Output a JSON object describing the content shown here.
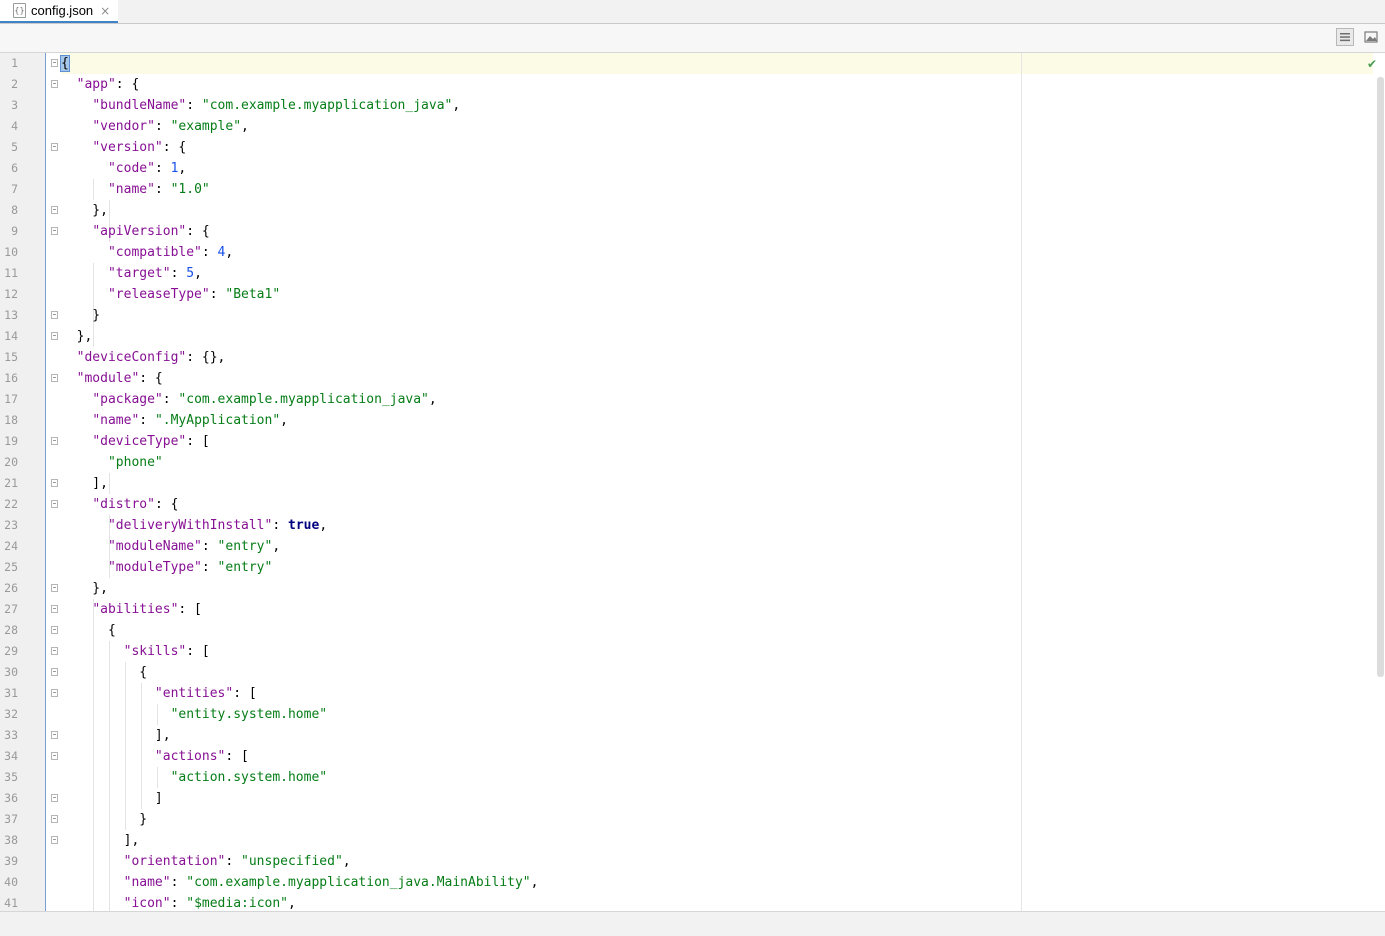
{
  "tab": {
    "label": "config.json",
    "icon": "json-file-icon",
    "close": "×"
  },
  "status": {
    "inspection": "✔"
  },
  "lines": [
    {
      "n": "1",
      "t": [
        [
          "p",
          "{"
        ]
      ]
    },
    {
      "n": "2",
      "t": [
        [
          "p",
          "  "
        ],
        [
          "k",
          "\"app\""
        ],
        [
          "p",
          ": {"
        ]
      ]
    },
    {
      "n": "3",
      "t": [
        [
          "p",
          "    "
        ],
        [
          "k",
          "\"bundleName\""
        ],
        [
          "p",
          ": "
        ],
        [
          "s",
          "\"com.example.myapplication_java\""
        ],
        [
          "p",
          ","
        ]
      ]
    },
    {
      "n": "4",
      "t": [
        [
          "p",
          "    "
        ],
        [
          "k",
          "\"vendor\""
        ],
        [
          "p",
          ": "
        ],
        [
          "s",
          "\"example\""
        ],
        [
          "p",
          ","
        ]
      ]
    },
    {
      "n": "5",
      "t": [
        [
          "p",
          "    "
        ],
        [
          "k",
          "\"version\""
        ],
        [
          "p",
          ": {"
        ]
      ]
    },
    {
      "n": "6",
      "t": [
        [
          "p",
          "      "
        ],
        [
          "k",
          "\"code\""
        ],
        [
          "p",
          ": "
        ],
        [
          "n",
          "1"
        ],
        [
          "p",
          ","
        ]
      ]
    },
    {
      "n": "7",
      "t": [
        [
          "p",
          "      "
        ],
        [
          "k",
          "\"name\""
        ],
        [
          "p",
          ": "
        ],
        [
          "s",
          "\"1.0\""
        ]
      ]
    },
    {
      "n": "8",
      "t": [
        [
          "p",
          "    },"
        ]
      ]
    },
    {
      "n": "9",
      "t": [
        [
          "p",
          "    "
        ],
        [
          "k",
          "\"apiVersion\""
        ],
        [
          "p",
          ": {"
        ]
      ]
    },
    {
      "n": "10",
      "t": [
        [
          "p",
          "      "
        ],
        [
          "k",
          "\"compatible\""
        ],
        [
          "p",
          ": "
        ],
        [
          "n",
          "4"
        ],
        [
          "p",
          ","
        ]
      ]
    },
    {
      "n": "11",
      "t": [
        [
          "p",
          "      "
        ],
        [
          "k",
          "\"target\""
        ],
        [
          "p",
          ": "
        ],
        [
          "n",
          "5"
        ],
        [
          "p",
          ","
        ]
      ]
    },
    {
      "n": "12",
      "t": [
        [
          "p",
          "      "
        ],
        [
          "k",
          "\"releaseType\""
        ],
        [
          "p",
          ": "
        ],
        [
          "s",
          "\"Beta1\""
        ]
      ]
    },
    {
      "n": "13",
      "t": [
        [
          "p",
          "    }"
        ]
      ]
    },
    {
      "n": "14",
      "t": [
        [
          "p",
          "  },"
        ]
      ]
    },
    {
      "n": "15",
      "t": [
        [
          "p",
          "  "
        ],
        [
          "k",
          "\"deviceConfig\""
        ],
        [
          "p",
          ": {},"
        ]
      ]
    },
    {
      "n": "16",
      "t": [
        [
          "p",
          "  "
        ],
        [
          "k",
          "\"module\""
        ],
        [
          "p",
          ": {"
        ]
      ]
    },
    {
      "n": "17",
      "t": [
        [
          "p",
          "    "
        ],
        [
          "k",
          "\"package\""
        ],
        [
          "p",
          ": "
        ],
        [
          "s",
          "\"com.example.myapplication_java\""
        ],
        [
          "p",
          ","
        ]
      ]
    },
    {
      "n": "18",
      "t": [
        [
          "p",
          "    "
        ],
        [
          "k",
          "\"name\""
        ],
        [
          "p",
          ": "
        ],
        [
          "s",
          "\".MyApplication\""
        ],
        [
          "p",
          ","
        ]
      ]
    },
    {
      "n": "19",
      "t": [
        [
          "p",
          "    "
        ],
        [
          "k",
          "\"deviceType\""
        ],
        [
          "p",
          ": ["
        ]
      ]
    },
    {
      "n": "20",
      "t": [
        [
          "p",
          "      "
        ],
        [
          "s",
          "\"phone\""
        ]
      ]
    },
    {
      "n": "21",
      "t": [
        [
          "p",
          "    ],"
        ]
      ]
    },
    {
      "n": "22",
      "t": [
        [
          "p",
          "    "
        ],
        [
          "k",
          "\"distro\""
        ],
        [
          "p",
          ": {"
        ]
      ]
    },
    {
      "n": "23",
      "t": [
        [
          "p",
          "      "
        ],
        [
          "k",
          "\"deliveryWithInstall\""
        ],
        [
          "p",
          ": "
        ],
        [
          "b",
          "true"
        ],
        [
          "p",
          ","
        ]
      ]
    },
    {
      "n": "24",
      "t": [
        [
          "p",
          "      "
        ],
        [
          "k",
          "\"moduleName\""
        ],
        [
          "p",
          ": "
        ],
        [
          "s",
          "\"entry\""
        ],
        [
          "p",
          ","
        ]
      ]
    },
    {
      "n": "25",
      "t": [
        [
          "p",
          "      "
        ],
        [
          "k",
          "\"moduleType\""
        ],
        [
          "p",
          ": "
        ],
        [
          "s",
          "\"entry\""
        ]
      ]
    },
    {
      "n": "26",
      "t": [
        [
          "p",
          "    },"
        ]
      ]
    },
    {
      "n": "27",
      "t": [
        [
          "p",
          "    "
        ],
        [
          "k",
          "\"abilities\""
        ],
        [
          "p",
          ": ["
        ]
      ]
    },
    {
      "n": "28",
      "t": [
        [
          "p",
          "      {"
        ]
      ]
    },
    {
      "n": "29",
      "t": [
        [
          "p",
          "        "
        ],
        [
          "k",
          "\"skills\""
        ],
        [
          "p",
          ": ["
        ]
      ]
    },
    {
      "n": "30",
      "t": [
        [
          "p",
          "          {"
        ]
      ]
    },
    {
      "n": "31",
      "t": [
        [
          "p",
          "            "
        ],
        [
          "k",
          "\"entities\""
        ],
        [
          "p",
          ": ["
        ]
      ]
    },
    {
      "n": "32",
      "t": [
        [
          "p",
          "              "
        ],
        [
          "s",
          "\"entity.system.home\""
        ]
      ]
    },
    {
      "n": "33",
      "t": [
        [
          "p",
          "            ],"
        ]
      ]
    },
    {
      "n": "34",
      "t": [
        [
          "p",
          "            "
        ],
        [
          "k",
          "\"actions\""
        ],
        [
          "p",
          ": ["
        ]
      ]
    },
    {
      "n": "35",
      "t": [
        [
          "p",
          "              "
        ],
        [
          "s",
          "\"action.system.home\""
        ]
      ]
    },
    {
      "n": "36",
      "t": [
        [
          "p",
          "            ]"
        ]
      ]
    },
    {
      "n": "37",
      "t": [
        [
          "p",
          "          }"
        ]
      ]
    },
    {
      "n": "38",
      "t": [
        [
          "p",
          "        ],"
        ]
      ]
    },
    {
      "n": "39",
      "t": [
        [
          "p",
          "        "
        ],
        [
          "k",
          "\"orientation\""
        ],
        [
          "p",
          ": "
        ],
        [
          "s",
          "\"unspecified\""
        ],
        [
          "p",
          ","
        ]
      ]
    },
    {
      "n": "40",
      "t": [
        [
          "p",
          "        "
        ],
        [
          "k",
          "\"name\""
        ],
        [
          "p",
          ": "
        ],
        [
          "s",
          "\"com.example.myapplication_java.MainAbility\""
        ],
        [
          "p",
          ","
        ]
      ]
    },
    {
      "n": "41",
      "t": [
        [
          "p",
          "        "
        ],
        [
          "k",
          "\"icon\""
        ],
        [
          "p",
          ": "
        ],
        [
          "s",
          "\"$media:icon\""
        ],
        [
          "p",
          ","
        ]
      ]
    }
  ],
  "folds": [
    "1",
    "2",
    "5",
    "8",
    "9",
    "13",
    "14",
    "16",
    "19",
    "21",
    "22",
    "26",
    "27",
    "28",
    "29",
    "30",
    "31",
    "33",
    "34",
    "36",
    "37",
    "38"
  ]
}
